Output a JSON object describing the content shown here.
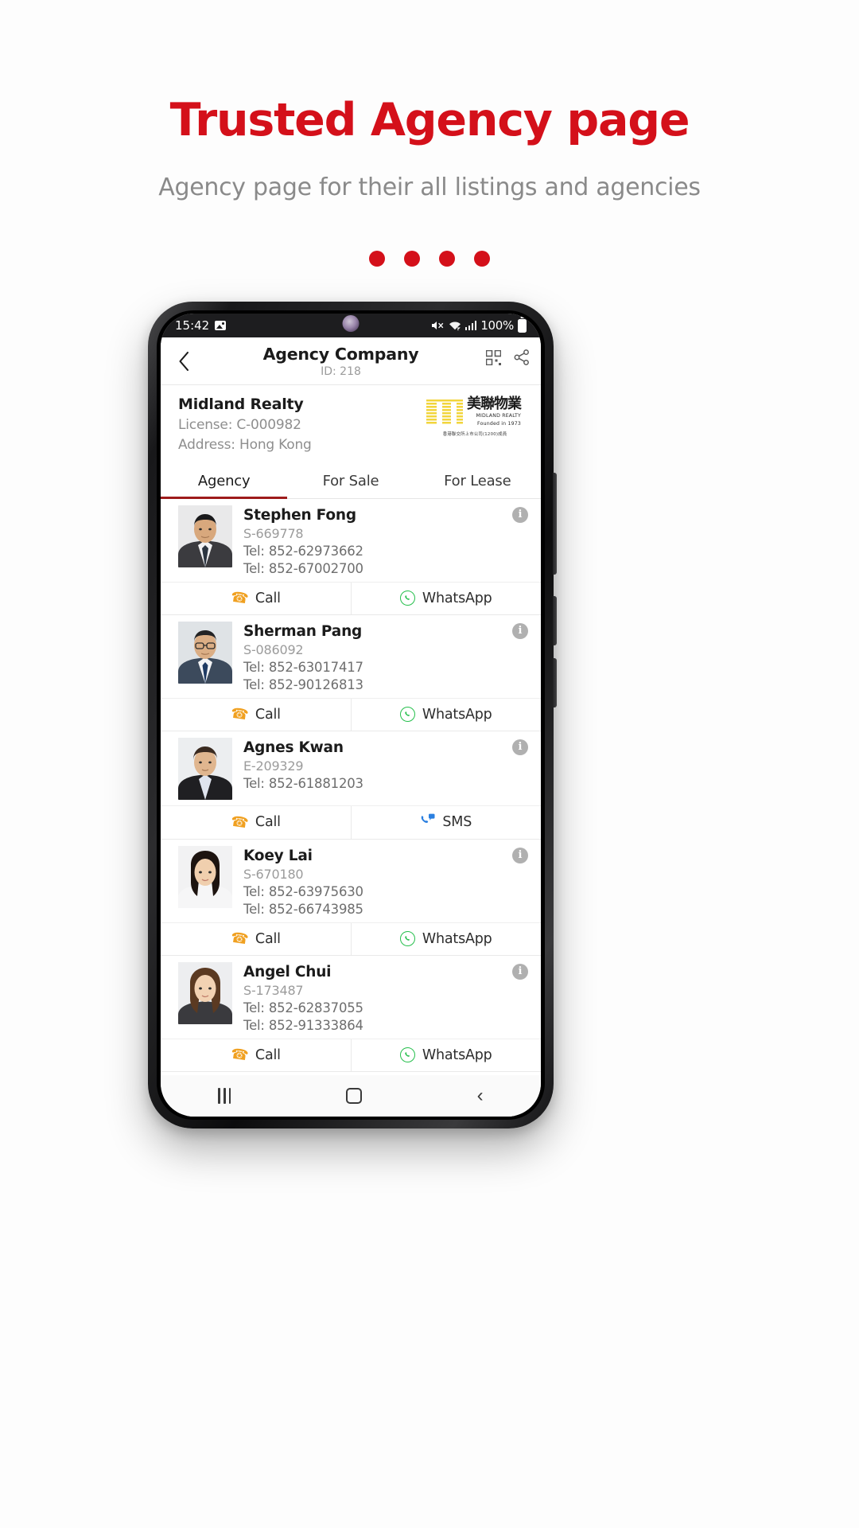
{
  "promo": {
    "title": "Trusted Agency page",
    "subtitle": "Agency page for their all listings and agencies",
    "accent_color": "#d4101a",
    "dot_count": 4
  },
  "status_bar": {
    "time": "15:42",
    "image_icon": "image-icon",
    "mute_icon": "mute-icon",
    "wifi_icon": "wifi-icon",
    "signal_icon": "signal-bars-icon",
    "battery_percent": "100%",
    "battery_icon": "battery-full-icon"
  },
  "app_bar": {
    "back_icon": "back-chevron-icon",
    "title": "Agency Company",
    "subtitle": "ID: 218",
    "qr_icon": "qr-code-icon",
    "share_icon": "share-icon"
  },
  "agency": {
    "name": "Midland Realty",
    "license": "License: C-000982",
    "address": "Address: Hong Kong",
    "logo": {
      "mark": "midland-m-icon",
      "chinese_name": "美聯物業",
      "english_name": "MIDLAND REALTY",
      "tagline": "Founded in 1973",
      "footer": "香港聯交所上市公司(1200)成員"
    }
  },
  "tabs": [
    {
      "label": "Agency",
      "active": true
    },
    {
      "label": "For Sale",
      "active": false
    },
    {
      "label": "For Lease",
      "active": false
    }
  ],
  "agents": [
    {
      "name": "Stephen Fong",
      "license": "S-669778",
      "tels": [
        "Tel: 852-62973662",
        "Tel: 852-67002700"
      ],
      "info_badge": "i",
      "actions": [
        {
          "label": "Call",
          "icon": "phone-icon"
        },
        {
          "label": "WhatsApp",
          "icon": "whatsapp-icon"
        }
      ],
      "avatar": "male-suit-dark"
    },
    {
      "name": "Sherman Pang",
      "license": "S-086092",
      "tels": [
        "Tel: 852-63017417",
        "Tel: 852-90126813"
      ],
      "info_badge": "i",
      "actions": [
        {
          "label": "Call",
          "icon": "phone-icon"
        },
        {
          "label": "WhatsApp",
          "icon": "whatsapp-icon"
        }
      ],
      "avatar": "male-glasses-blue"
    },
    {
      "name": "Agnes Kwan",
      "license": "E-209329",
      "tels": [
        "Tel: 852-61881203"
      ],
      "info_badge": "i",
      "actions": [
        {
          "label": "Call",
          "icon": "phone-icon"
        },
        {
          "label": "SMS",
          "icon": "sms-icon"
        }
      ],
      "avatar": "female-short-hair"
    },
    {
      "name": "Koey Lai",
      "license": "S-670180",
      "tels": [
        "Tel: 852-63975630",
        "Tel: 852-66743985"
      ],
      "info_badge": "i",
      "actions": [
        {
          "label": "Call",
          "icon": "phone-icon"
        },
        {
          "label": "WhatsApp",
          "icon": "whatsapp-icon"
        }
      ],
      "avatar": "female-long-hair"
    },
    {
      "name": "Angel Chui",
      "license": "S-173487",
      "tels": [
        "Tel: 852-62837055",
        "Tel: 852-91333864"
      ],
      "info_badge": "i",
      "actions": [
        {
          "label": "Call",
          "icon": "phone-icon"
        },
        {
          "label": "WhatsApp",
          "icon": "whatsapp-icon"
        }
      ],
      "avatar": "female-brown-hair"
    }
  ],
  "nav_bar": {
    "recents_icon": "recents-icon",
    "home_icon": "home-icon",
    "back_icon": "back-icon"
  }
}
